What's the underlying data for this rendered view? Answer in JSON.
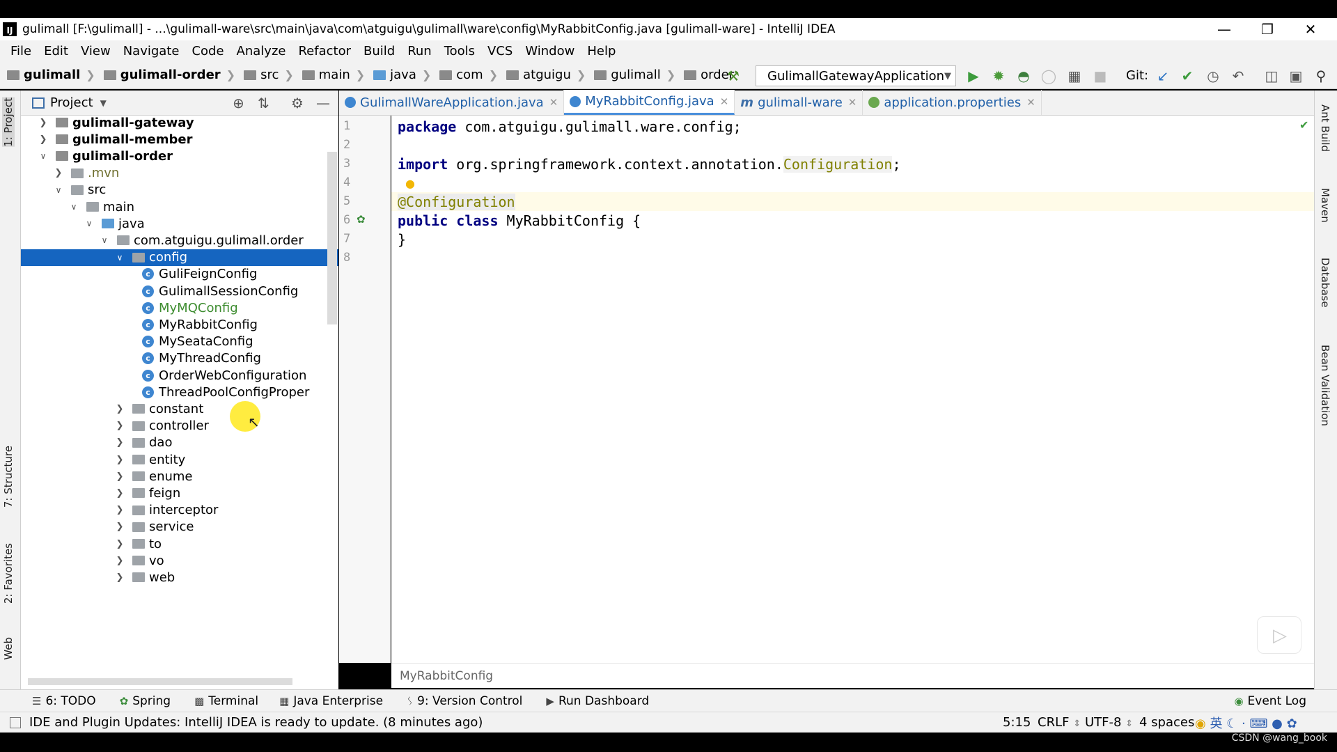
{
  "window": {
    "title": "gulimall [F:\\gulimall] - ...\\gulimall-ware\\src\\main\\java\\com\\atguigu\\gulimall\\ware\\config\\MyRabbitConfig.java [gulimall-ware] - IntelliJ IDEA",
    "app_icon": "IJ"
  },
  "menu": [
    "File",
    "Edit",
    "View",
    "Navigate",
    "Code",
    "Analyze",
    "Refactor",
    "Build",
    "Run",
    "Tools",
    "VCS",
    "Window",
    "Help"
  ],
  "breadcrumbs": [
    "gulimall",
    "gulimall-order",
    "src",
    "main",
    "java",
    "com",
    "atguigu",
    "gulimall",
    "order"
  ],
  "run_config": "GulimallGatewayApplication",
  "git_label": "Git:",
  "project_panel": {
    "title": "Project"
  },
  "tree": [
    {
      "label": "gulimall-gateway",
      "state": "collapsed",
      "kind": "module"
    },
    {
      "label": "gulimall-member",
      "state": "collapsed",
      "kind": "module"
    },
    {
      "label": "gulimall-order",
      "state": "expanded",
      "kind": "module"
    },
    {
      "label": ".mvn",
      "state": "collapsed",
      "kind": "folder"
    },
    {
      "label": "src",
      "state": "expanded",
      "kind": "folder"
    },
    {
      "label": "main",
      "state": "expanded",
      "kind": "folder"
    },
    {
      "label": "java",
      "state": "expanded",
      "kind": "folder"
    },
    {
      "label": "com.atguigu.gulimall.order",
      "state": "expanded",
      "kind": "package"
    },
    {
      "label": "config",
      "state": "expanded",
      "kind": "package",
      "selected": true
    },
    {
      "label": "GuliFeignConfig",
      "kind": "class"
    },
    {
      "label": "GulimallSessionConfig",
      "kind": "class"
    },
    {
      "label": "MyMQConfig",
      "kind": "class",
      "color": "green"
    },
    {
      "label": "MyRabbitConfig",
      "kind": "class"
    },
    {
      "label": "MySeataConfig",
      "kind": "class"
    },
    {
      "label": "MyThreadConfig",
      "kind": "class"
    },
    {
      "label": "OrderWebConfiguration",
      "kind": "class"
    },
    {
      "label": "ThreadPoolConfigProper",
      "kind": "class"
    },
    {
      "label": "constant",
      "state": "collapsed",
      "kind": "package"
    },
    {
      "label": "controller",
      "state": "collapsed",
      "kind": "package"
    },
    {
      "label": "dao",
      "state": "collapsed",
      "kind": "package"
    },
    {
      "label": "entity",
      "state": "collapsed",
      "kind": "package"
    },
    {
      "label": "enume",
      "state": "collapsed",
      "kind": "package"
    },
    {
      "label": "feign",
      "state": "collapsed",
      "kind": "package"
    },
    {
      "label": "interceptor",
      "state": "collapsed",
      "kind": "package"
    },
    {
      "label": "service",
      "state": "collapsed",
      "kind": "package"
    },
    {
      "label": "to",
      "state": "collapsed",
      "kind": "package"
    },
    {
      "label": "vo",
      "state": "collapsed",
      "kind": "package"
    },
    {
      "label": "web",
      "state": "collapsed",
      "kind": "package"
    }
  ],
  "tabs": [
    {
      "label": "GulimallWareApplication.java",
      "icon": "class-icon"
    },
    {
      "label": "MyRabbitConfig.java",
      "icon": "class-icon",
      "active": true
    },
    {
      "label": "gulimall-ware",
      "icon": "maven-icon"
    },
    {
      "label": "application.properties",
      "icon": "properties-icon"
    }
  ],
  "editor": {
    "line_numbers": [
      "1",
      "2",
      "3",
      "4",
      "5",
      "6",
      "7",
      "8"
    ],
    "line1": {
      "kw": "package",
      "rest": " com.atguigu.gulimall.ware.config;"
    },
    "line3": {
      "kw": "import",
      "rest": " org.springframework.context.annotation.",
      "ann": "Configuration",
      "end": ";"
    },
    "line5": "@Configuration",
    "line6": {
      "kw": "public class",
      "rest": " MyRabbitConfig {"
    },
    "line7": "}",
    "breadcrumb": "MyRabbitConfig"
  },
  "left_tools": [
    "1: Project",
    "7: Structure",
    "2: Favorites",
    "Web"
  ],
  "right_tools": [
    "Ant Build",
    "Maven",
    "Database",
    "Bean Validation"
  ],
  "tool_windows": [
    {
      "label": "6: TODO",
      "icon": "list-icon"
    },
    {
      "label": "Spring",
      "icon": "spring-icon"
    },
    {
      "label": "Terminal",
      "icon": "terminal-icon"
    },
    {
      "label": "Java Enterprise",
      "icon": "java-enterprise-icon"
    },
    {
      "label": "9: Version Control",
      "icon": "vcs-icon"
    },
    {
      "label": "Run Dashboard",
      "icon": "run-dashboard-icon"
    }
  ],
  "event_log": "Event Log",
  "status": {
    "message": "IDE and Plugin Updates: IntelliJ IDEA is ready to update. (8 minutes ago)",
    "position": "5:15",
    "line_sep": "CRLF",
    "encoding": "UTF-8",
    "indent": "4 spaces",
    "ime": "英"
  },
  "watermark": "CSDN @wang_book",
  "colors": {
    "selection": "#1565c0",
    "keyword": "#000080",
    "annotation": "#808000"
  }
}
